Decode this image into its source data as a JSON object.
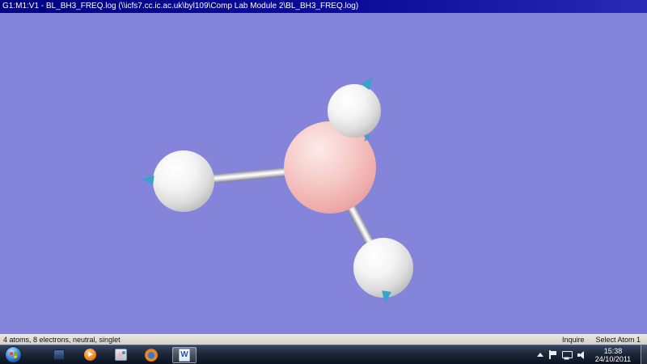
{
  "window": {
    "title": "G1:M1:V1 - BL_BH3_FREQ.log (\\\\icfs7.cc.ic.ac.uk\\byl109\\Comp Lab Module 2\\BL_BH3_FREQ.log)"
  },
  "viewport": {
    "background_color": "#8484da",
    "molecule": {
      "formula": "BH3",
      "boron_color": "#f2bdbb",
      "hydrogen_color": "#f5f5f5",
      "bond_color": "#e6e6ec",
      "vibration_vector_color": "#35a3cc",
      "atoms": [
        {
          "element": "B",
          "position": "center"
        },
        {
          "element": "H",
          "position": "top"
        },
        {
          "element": "H",
          "position": "left"
        },
        {
          "element": "H",
          "position": "bottom"
        }
      ]
    }
  },
  "statusbar": {
    "left": "4 atoms, 8 electrons, neutral, singlet",
    "mode": "Inquire",
    "action": "Select Atom 1"
  },
  "taskbar": {
    "icons": [
      "start",
      "app",
      "media-player",
      "gaussview",
      "firefox",
      "word"
    ],
    "active_icon": "word",
    "word_letter": "W",
    "time": "15:38",
    "date": "24/10/2011"
  }
}
